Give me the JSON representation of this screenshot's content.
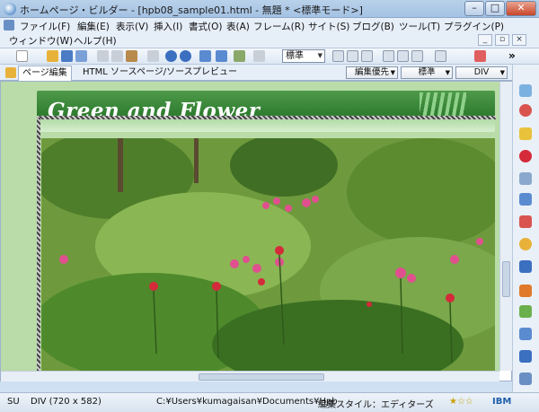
{
  "window": {
    "title": "ホームページ・ビルダー - [hpb08_sample01.html - 無題 * <標準モード>]",
    "controls": {
      "minimize": "–",
      "maximize": "□",
      "close": "✕"
    }
  },
  "menu": {
    "row1": [
      "ファイル(F)",
      "編集(E)",
      "表示(V)",
      "挿入(I)",
      "書式(O)",
      "表(A)",
      "フレーム(R)",
      "サイト(S)",
      "ブログ(B)",
      "ツール(T)",
      "プラグイン(P)"
    ],
    "row2": [
      "ウィンドウ(W)",
      "ヘルプ(H)"
    ],
    "mdi": {
      "minimize": "_",
      "restore": "▫",
      "close": "×"
    }
  },
  "toolbar": {
    "style_select": "標準",
    "more": "»"
  },
  "tabs": [
    {
      "label": "ページ編集",
      "active": true
    },
    {
      "label": "HTML ソース",
      "active": false
    },
    {
      "label": "ページ/ソース",
      "active": false
    },
    {
      "label": "プレビュー",
      "active": false
    }
  ],
  "tab_selects": {
    "edit_priority": "編集優先",
    "standard": "標準",
    "div": "DIV"
  },
  "page": {
    "header_title": "Green and Flower"
  },
  "status": {
    "mode": "SU",
    "element": "DIV (720 x 582)",
    "path": "C:¥Users¥kumagaisan¥Documents¥Hpb",
    "style": "編集スタイル：エディターズ",
    "rating": "★☆☆",
    "brand": "IBM"
  },
  "colors": {
    "accent": "#2e7c2f",
    "page_bg": "#b9dca8",
    "chrome": "#cfe0f3"
  }
}
